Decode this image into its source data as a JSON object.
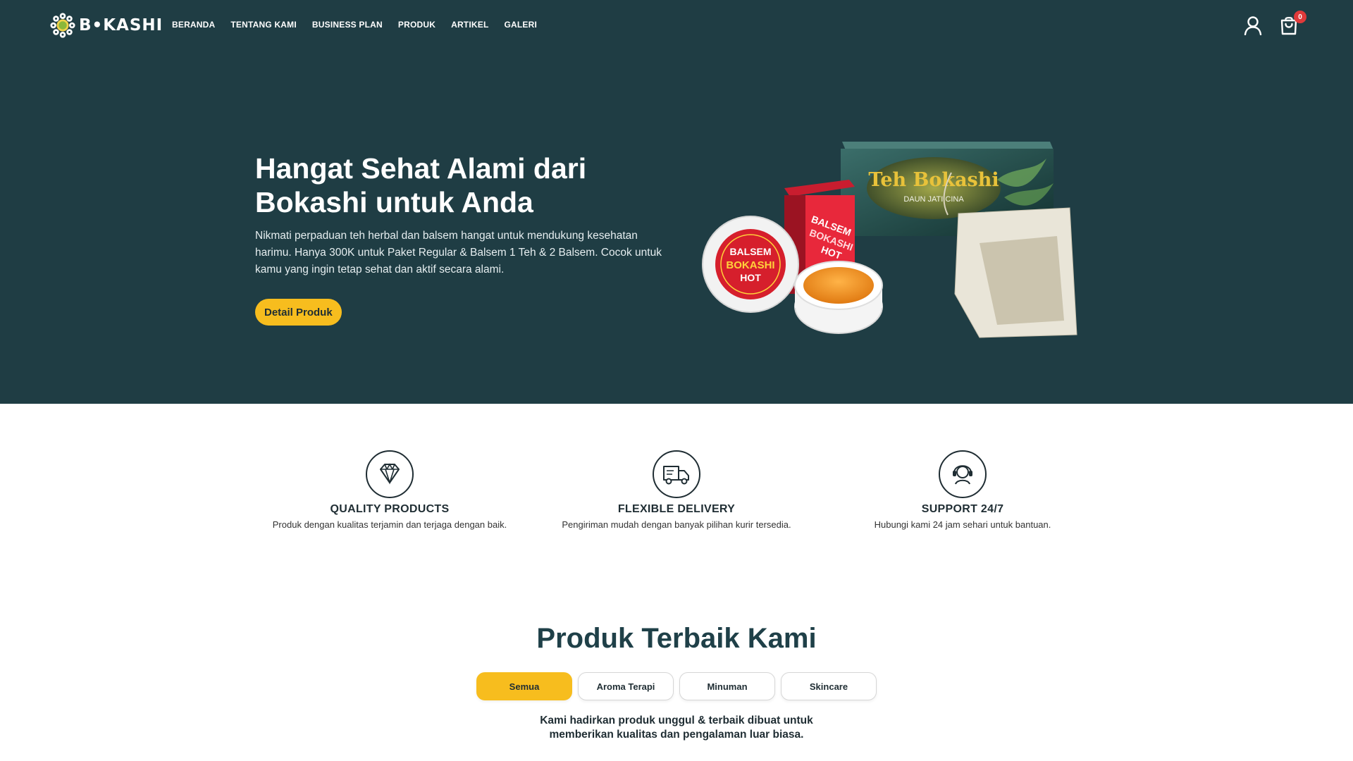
{
  "brand": {
    "name": "B•KASHI"
  },
  "nav": {
    "links": [
      "BERANDA",
      "TENTANG KAMI",
      "BUSINESS PLAN",
      "PRODUK",
      "ARTIKEL",
      "GALERI"
    ],
    "cart_count": "0",
    "icons": [
      "user-icon",
      "cart-icon"
    ]
  },
  "hero": {
    "title_line1": "Hangat Sehat Alami dari",
    "title_line2": "Bokashi untuk Anda",
    "description": "Nikmati perpaduan teh herbal dan balsem hangat untuk mendukung kesehatan harimu. Hanya 300K untuk Paket Regular & Balsem 1 Teh & 2 Balsem. Cocok untuk kamu yang ingin tetap sehat dan aktif secara alami.",
    "cta_label": "Detail Produk",
    "image": {
      "tea_box_title": "Teh Bokashi",
      "tea_box_subtitle": "DAUN JATI CINA",
      "balm_label_line1": "BALSEM",
      "balm_label_line2": "BOKASHI",
      "balm_label_line3": "HOT"
    }
  },
  "features": [
    {
      "icon": "diamond-icon",
      "title": "QUALITY PRODUCTS",
      "desc": "Produk dengan kualitas terjamin dan terjaga dengan baik."
    },
    {
      "icon": "truck-icon",
      "title": "FLEXIBLE DELIVERY",
      "desc": "Pengiriman mudah dengan banyak pilihan kurir tersedia."
    },
    {
      "icon": "support-icon",
      "title": "SUPPORT 24/7",
      "desc": "Hubungi kami 24 jam sehari untuk bantuan."
    }
  ],
  "products": {
    "title": "Produk Terbaik Kami",
    "tabs": [
      "Semua",
      "Aroma Terapi",
      "Minuman",
      "Skincare"
    ],
    "active_tab": "Semua",
    "subtitle_line1": "Kami hadirkan produk unggul & terbaik dibuat untuk",
    "subtitle_line2": "memberikan kualitas dan pengalaman luar biasa."
  },
  "colors": {
    "hero_bg": "#1f3d44",
    "accent": "#f7bd1e",
    "badge": "#e03a3a",
    "heading": "#1f4048"
  }
}
